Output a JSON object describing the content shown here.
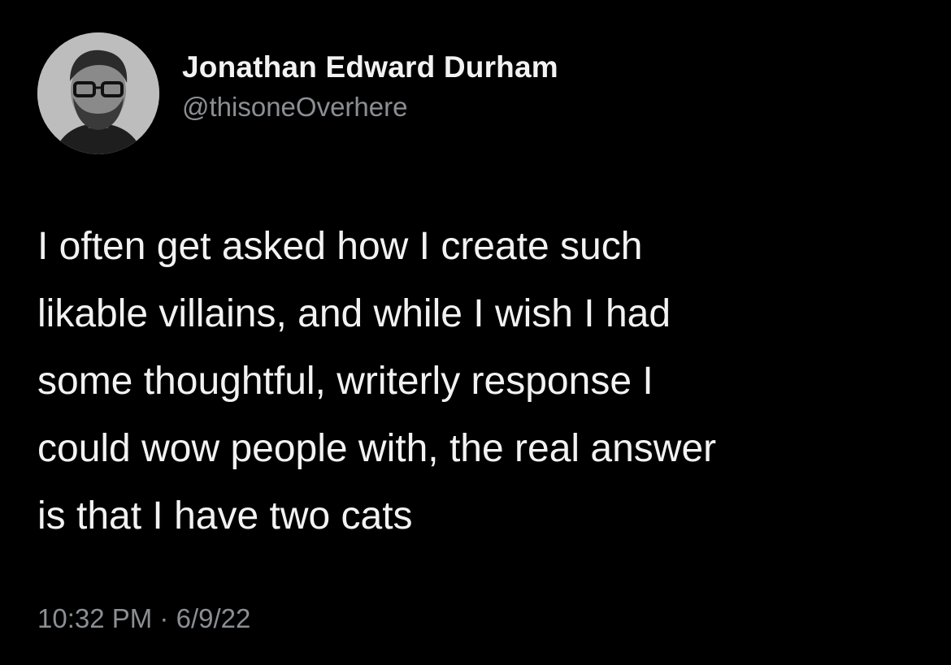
{
  "tweet": {
    "author": {
      "display_name": "Jonathan Edward Durham",
      "handle": "@thisoneOverhere",
      "avatar_icon": "profile-photo-icon"
    },
    "text_lines": [
      "I often get asked how I create such",
      "likable villains, and while I wish I had",
      "some thoughtful, writerly response I",
      "could wow people with, the real answer",
      "is that I have two cats"
    ],
    "time": "10:32 PM",
    "separator": "·",
    "date": "6/9/22"
  },
  "colors": {
    "background": "#000000",
    "primary_text": "#f2f2f2",
    "secondary_text": "#8b8f94"
  }
}
